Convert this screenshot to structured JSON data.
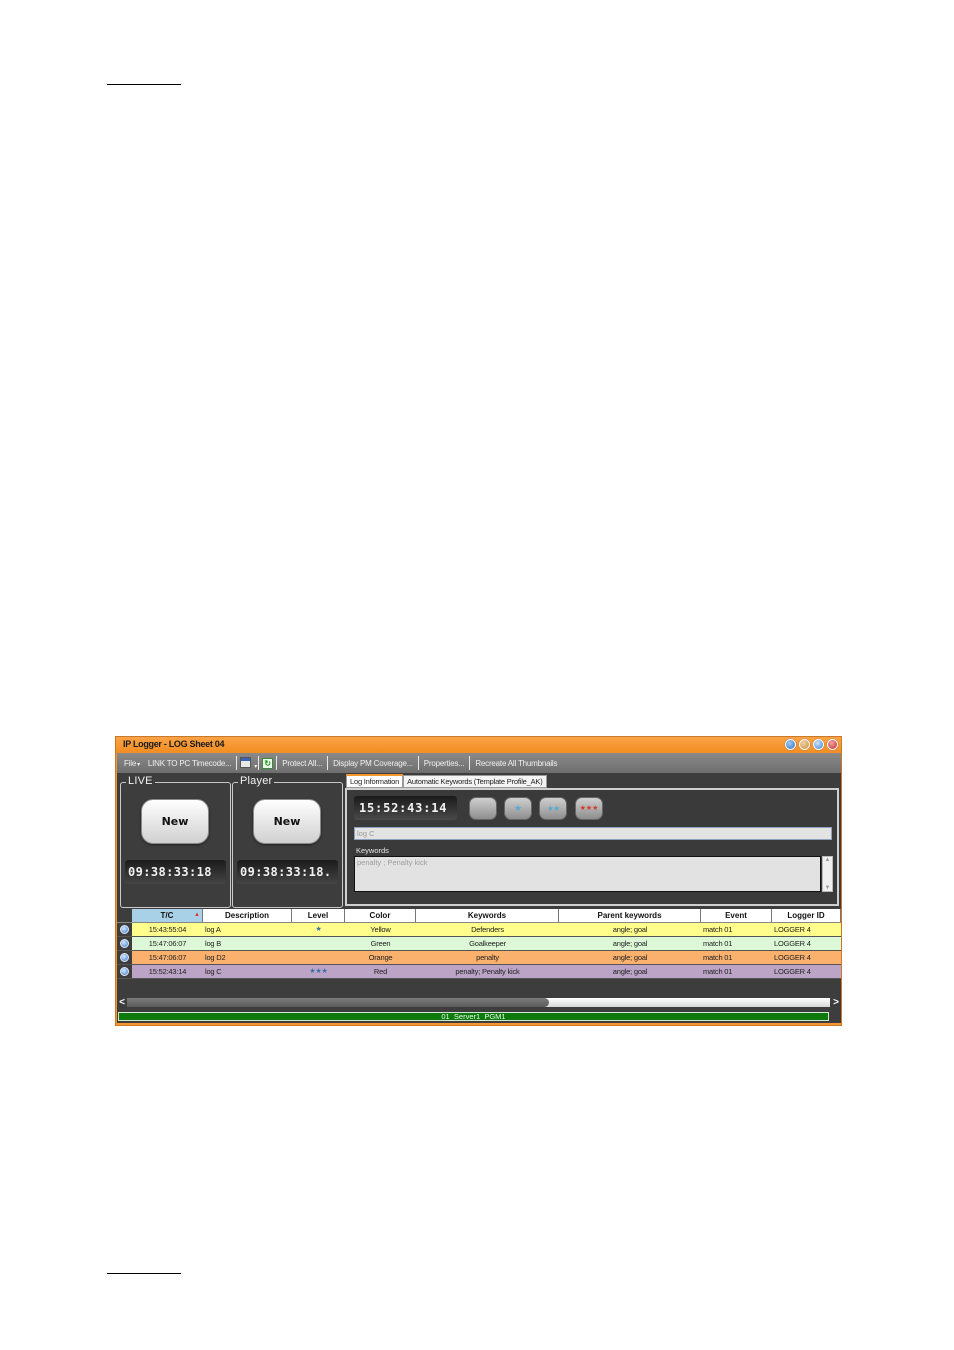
{
  "window": {
    "title": "IP Logger - LOG Sheet 04",
    "controls": [
      "help-icon",
      "minimize-icon",
      "maximize-icon",
      "close-icon"
    ]
  },
  "toolbar": {
    "file": "File",
    "link_tc": "LINK TO PC Timecode...",
    "calendar_icon": "calendar-icon",
    "refresh_icon": "refresh-icon",
    "refresh_glyph": "↻",
    "protect_all": "Protect All...",
    "display_pm": "Display PM Coverage...",
    "properties": "Properties...",
    "recreate": "Recreate All Thumbnails",
    "caret": "▾"
  },
  "live": {
    "label": "LIVE",
    "new_label": "New",
    "timecode": "09:38:33:18"
  },
  "player": {
    "label": "Player",
    "new_label": "New",
    "timecode": "09:38:33:18."
  },
  "tabs": [
    {
      "label": "Log Information",
      "active": true
    },
    {
      "label": "Automatic Keywords (Template Profile_AK)",
      "active": false
    }
  ],
  "log_info": {
    "timecode": "15:52:43:14",
    "level_buttons": [
      {
        "stars": 0,
        "glyph": ""
      },
      {
        "stars": 1,
        "glyph": "★"
      },
      {
        "stars": 2,
        "glyph": "★★"
      },
      {
        "stars": 3,
        "glyph": "★★★"
      }
    ],
    "description": "log C",
    "keywords_label": "Keywords",
    "keywords_value": "penalty ;  Penalty kick",
    "scroll_up": "▲",
    "scroll_down": "▼"
  },
  "grid": {
    "sort_arrow": "▲",
    "columns": [
      "",
      "T/C",
      "Description",
      "Level",
      "Color",
      "Keywords",
      "Parent keywords",
      "Event",
      "Logger ID"
    ],
    "rows": [
      {
        "tc": "15:43:55:04",
        "description": "log A",
        "level": "★",
        "color": "Yellow",
        "keywords": "Defenders",
        "parent": "angle; goal",
        "event": "match 01",
        "logger": "LOGGER 4",
        "bg": "#fffd8c"
      },
      {
        "tc": "15:47:06:07",
        "description": "log B",
        "level": "",
        "color": "Green",
        "keywords": "Goalkeeper",
        "parent": "angle; goal",
        "event": "match 01",
        "logger": "LOGGER 4",
        "bg": "#dcf8d6"
      },
      {
        "tc": "15:47:06:07",
        "description": "log D2",
        "level": "",
        "color": "Orange",
        "keywords": "penalty",
        "parent": "angle; goal",
        "event": "match 01",
        "logger": "LOGGER 4",
        "bg": "#fbb16e"
      },
      {
        "tc": "15:52:43:14",
        "description": "log C",
        "level": "★★★",
        "color": "Red",
        "keywords": "penalty; Penalty kick",
        "parent": "angle; goal",
        "event": "match 01",
        "logger": "LOGGER 4",
        "bg": "#bca4c6"
      }
    ]
  },
  "scrollbar": {
    "left": "<",
    "right": ">",
    "position_fraction": 0.6
  },
  "status": {
    "text": "01_Server1_PGM1"
  },
  "colors": {
    "accent": "#f7962f",
    "panel": "#3d3d3d",
    "status_green": "#0e7a0e"
  }
}
